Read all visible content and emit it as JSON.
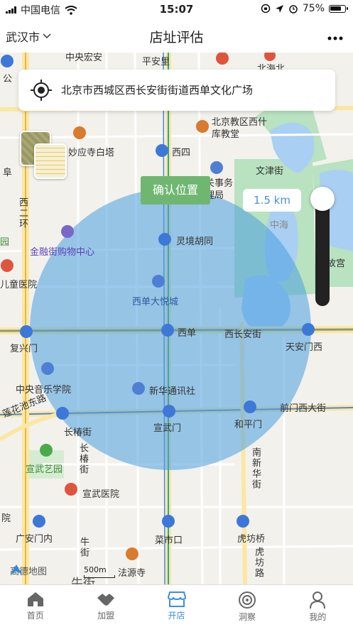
{
  "status_bar": {
    "carrier": "中国电信",
    "time": "15:07",
    "battery": "75%"
  },
  "nav": {
    "city": "武汉市",
    "title": "店址评估"
  },
  "search": {
    "address": "北京市西城区西长安街街道西单文化广场"
  },
  "map": {
    "confirm_label": "确认位置",
    "radius_label": "1.5 km",
    "radius_km": 1.5,
    "logo": "高德地图",
    "scale": "500m",
    "labels": {
      "zhongjiaxi": "中央宏安",
      "pinganli": "平安里",
      "beihai": "北海北",
      "gong": "公",
      "baitasi": "妙应寺白塔",
      "xisi": "西四",
      "church": "北京教区西什库教堂",
      "wenjinjie": "文津街",
      "fuyu": "阜",
      "jiguan": "机关事务管理局",
      "xi": "西二环",
      "lingjing": "灵境胡同",
      "zhonghai": "中海",
      "jinrongjie": "金融街购物中心",
      "gugong": "故宫",
      "yuan": "园",
      "ertong": "儿童医院",
      "xidan_joy": "西单大悦城",
      "xidan": "西单",
      "xichangan": "西长安街",
      "tiananmen_w": "天安门西",
      "fuxingmen": "复兴门",
      "yinyue": "中央音乐学院",
      "xinhua": "新华通讯社",
      "huachi": "莲花池东路",
      "qianmen": "前门西大街",
      "changchun": "长椿街",
      "xuanwumen": "宣武门",
      "hepingmen": "和平门",
      "changchun_v": "长椿街",
      "nanxinhua": "南新华街",
      "xuanwuyi": "宣武艺园",
      "xuanwuhosp": "宣武医院",
      "yuan2": "院",
      "guanganmen": "广安门内",
      "caishikou": "菜市口",
      "hufangqiao": "虎坊桥",
      "niujie": "牛街",
      "hufanglu": "虎坊路",
      "fayuansi": "法源寺",
      "niujie2": "牛街"
    }
  },
  "tabs": [
    {
      "label": "首页",
      "icon": "home-icon"
    },
    {
      "label": "加盟",
      "icon": "handshake-icon"
    },
    {
      "label": "开店",
      "icon": "store-icon"
    },
    {
      "label": "洞察",
      "icon": "target-icon"
    },
    {
      "label": "我的",
      "icon": "person-icon"
    }
  ],
  "active_tab": "开店",
  "colors": {
    "accent": "#3d8de0",
    "confirm_green": "#6fb771",
    "radius_fill": "#4a9ee0"
  }
}
